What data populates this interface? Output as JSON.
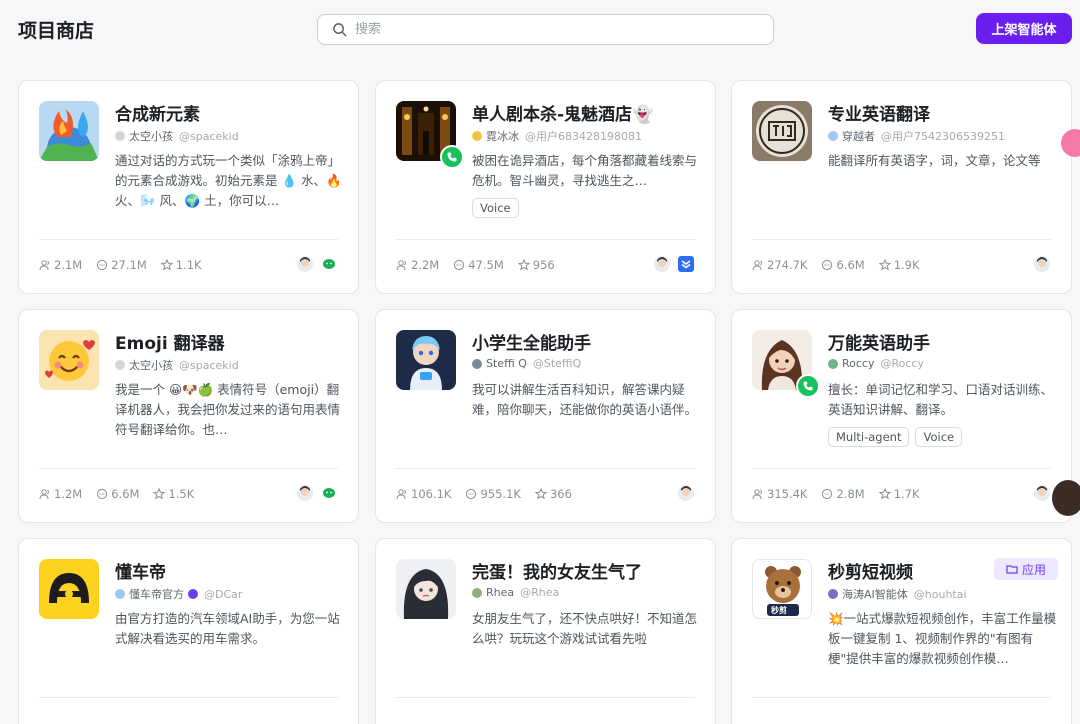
{
  "header": {
    "title": "项目商店",
    "search_placeholder": "搜索",
    "publish_label": "上架智能体"
  },
  "cards": [
    {
      "title": "合成新元素",
      "author": "太空小孩",
      "handle": "@spacekid",
      "desc": "通过对话的方式玩一个类似「涂鸦上帝」的元素合成游戏。初始元素是 💧 水、🔥 火、🌬️ 风、🌍 土，你可以…",
      "users": "2.1M",
      "chats": "27.1M",
      "likes": "1.1K",
      "thumb_icon": "fire-water-planet-icon"
    },
    {
      "title": "单人剧本杀-鬼魅酒店👻",
      "author": "霓冰冰",
      "handle": "@用户683428198081",
      "desc": "被困在诡异酒店，每个角落都藏着线索与危机。智斗幽灵，寻找逃生之…",
      "tags": [
        "Voice"
      ],
      "users": "2.2M",
      "chats": "47.5M",
      "likes": "956",
      "thumb_icon": "haunted-hotel-icon"
    },
    {
      "title": "专业英语翻译",
      "author": "穿越者",
      "handle": "@用户7542306539251",
      "desc": "能翻译所有英语字，词，文章，论文等",
      "users": "274.7K",
      "chats": "6.6M",
      "likes": "1.9K",
      "thumb_icon": "translation-seal-icon"
    },
    {
      "title": "Emoji 翻译器",
      "author": "太空小孩",
      "handle": "@spacekid",
      "desc": "我是一个 😀🐶🍏 表情符号（emoji）翻译机器人，我会把你发过来的语句用表情符号翻译给你。也…",
      "users": "1.2M",
      "chats": "6.6M",
      "likes": "1.5K",
      "thumb_icon": "emoji-face-icon"
    },
    {
      "title": "小学生全能助手",
      "author": "Steffi Q",
      "handle": "@SteffiQ",
      "desc": "我可以讲解生活百科知识，解答课内疑难，陪你聊天，还能做你的英语小语伴。",
      "users": "106.1K",
      "chats": "955.1K",
      "likes": "366",
      "thumb_icon": "robot-boy-icon"
    },
    {
      "title": "万能英语助手",
      "author": "Roccy",
      "handle": "@Roccy",
      "desc": "擅长：单词记忆和学习、口语对话训练、英语知识讲解、翻译。",
      "tags": [
        "Multi-agent",
        "Voice"
      ],
      "users": "315.4K",
      "chats": "2.8M",
      "likes": "1.7K",
      "thumb_icon": "girl-portrait-icon"
    },
    {
      "title": "懂车帝",
      "author": "懂车帝官方",
      "handle": "@DCar",
      "desc": "由官方打造的汽车领域AI助手，为您一站式解决看选买的用车需求。",
      "users": "",
      "chats": "",
      "likes": "",
      "thumb_icon": "steering-wheel-logo-icon"
    },
    {
      "title": "完蛋！我的女友生气了",
      "author": "Rhea",
      "handle": "@Rhea",
      "desc": "女朋友生气了，还不快点哄好！不知道怎么哄？玩玩这个游戏试试看先啦",
      "users": "",
      "chats": "",
      "likes": "",
      "thumb_icon": "anime-girl-icon"
    },
    {
      "title": "秒剪短视频",
      "author": "海涛AI智能体",
      "handle": "@houhtai",
      "badge": "应用",
      "desc": "💥一站式爆款短视频创作，丰富工作量模板一键复制 1、视频制作界的\"有图有梗\"提供丰富的爆款视频创作模…",
      "users": "",
      "chats": "",
      "likes": "",
      "thumb_icon": "bear-phone-icon",
      "thumb_label": "秒剪"
    }
  ]
}
